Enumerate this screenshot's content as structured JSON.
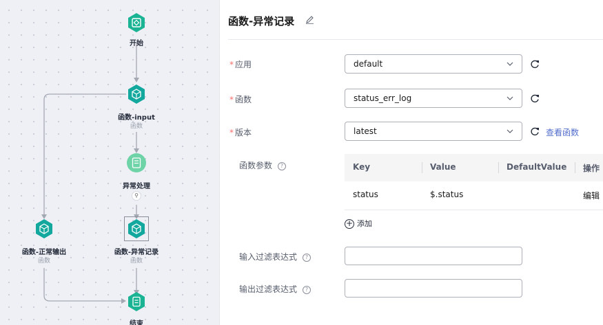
{
  "canvas": {
    "nodes": {
      "start": {
        "label": "开始"
      },
      "func_input": {
        "label": "函数-input",
        "sub": "函数"
      },
      "exception": {
        "label": "异常处理"
      },
      "func_normal": {
        "label": "函数-正常输出",
        "sub": "函数"
      },
      "func_error": {
        "label": "函数-异常记录",
        "sub": "函数"
      },
      "end": {
        "label": "结束"
      }
    },
    "colors": {
      "node": "#13a89e",
      "start_node": "#1ab394",
      "exception_node": "#6fd3a8",
      "edge": "#a4a8b3"
    }
  },
  "panel": {
    "title": "函数-异常记录",
    "fields": {
      "app": {
        "label": "应用",
        "value": "default"
      },
      "func": {
        "label": "函数",
        "value": "status_err_log"
      },
      "version": {
        "label": "版本",
        "value": "latest",
        "link": "查看函数"
      },
      "params": {
        "label": "函数参数"
      },
      "input_filter": {
        "label": "输入过滤表达式",
        "value": ""
      },
      "output_filter": {
        "label": "输出过滤表达式",
        "value": ""
      }
    },
    "required_mark": "*",
    "help_mark": "?",
    "table": {
      "headers": [
        "Key",
        "Value",
        "DefaultValue",
        "操作"
      ],
      "rows": [
        {
          "key": "status",
          "value": "$.status",
          "default": "",
          "action": "编辑"
        }
      ]
    },
    "add_label": "添加",
    "colors": {
      "link": "#526ecc",
      "required": "#f66f6a"
    }
  }
}
